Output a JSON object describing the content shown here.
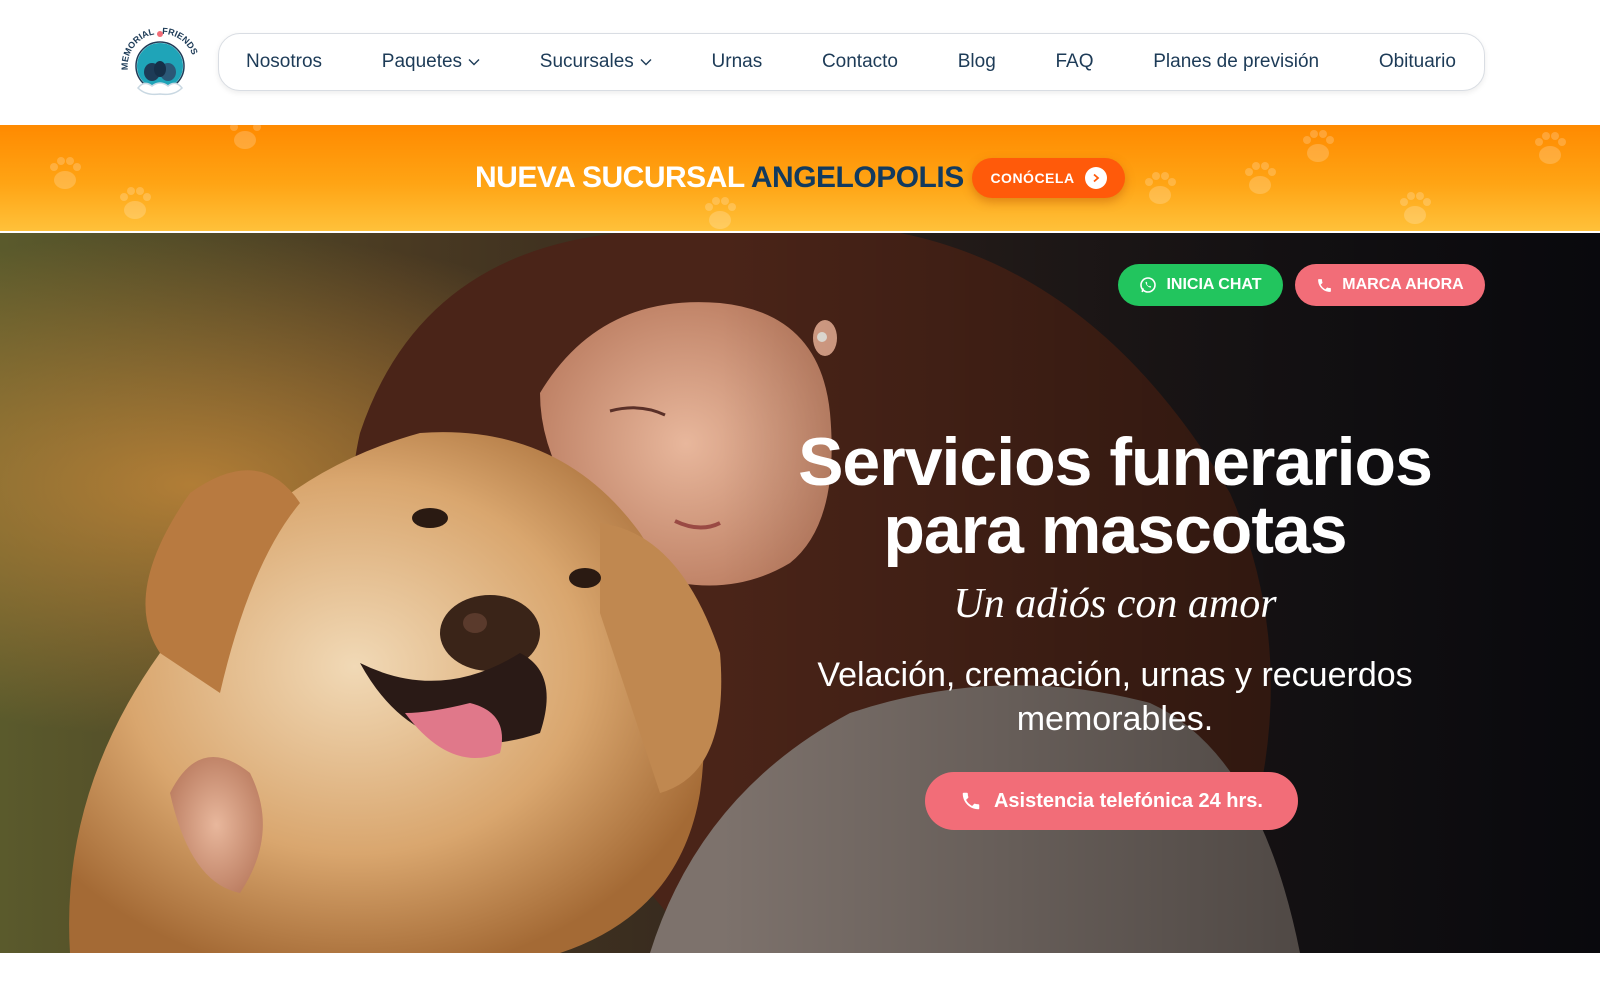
{
  "brand": {
    "logo_text_left": "MEMORIAL",
    "logo_text_right": "FRIENDS",
    "logo_icon": "memorial-friends-logo-icon"
  },
  "nav": {
    "items": [
      {
        "label": "Nosotros",
        "has_dropdown": false
      },
      {
        "label": "Paquetes",
        "has_dropdown": true
      },
      {
        "label": "Sucursales",
        "has_dropdown": true
      },
      {
        "label": "Urnas",
        "has_dropdown": false
      },
      {
        "label": "Contacto",
        "has_dropdown": false
      },
      {
        "label": "Blog",
        "has_dropdown": false
      },
      {
        "label": "FAQ",
        "has_dropdown": false
      },
      {
        "label": "Planes de previsión",
        "has_dropdown": false
      },
      {
        "label": "Obituario",
        "has_dropdown": false
      }
    ]
  },
  "promo": {
    "text_white": "NUEVA SUCURSAL",
    "text_blue": "ANGELOPOLIS",
    "button_label": "CONÓCELA",
    "button_icon": "chevron-right-icon"
  },
  "hero": {
    "chat_button": "INICIA CHAT",
    "chat_icon": "whatsapp-icon",
    "call_button": "MARCA AHORA",
    "call_icon": "phone-icon",
    "title_line1": "Servicios funerarios",
    "title_line2": "para mascotas",
    "subtitle": "Un adiós con amor",
    "description_line1": "Velación, cremación, urnas y recuerdos",
    "description_line2": "memorables.",
    "assist_button": "Asistencia telefónica 24 hrs.",
    "image_subject": "woman hugging golden retriever"
  },
  "colors": {
    "nav_text": "#1d3b57",
    "banner_orange": "#ff9500",
    "banner_button": "#ff5a0a",
    "brand_blue": "#123a5e",
    "whatsapp_green": "#22c55e",
    "coral": "#f26d78"
  }
}
